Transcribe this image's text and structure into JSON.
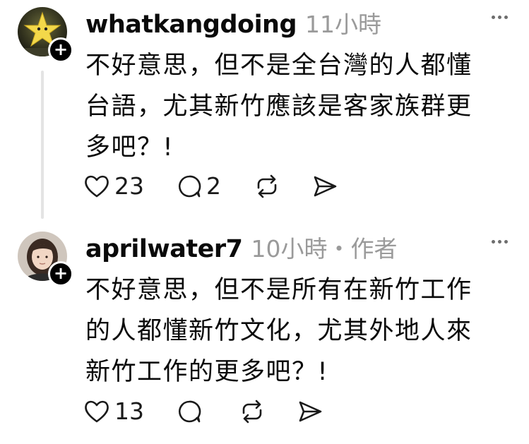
{
  "posts": [
    {
      "username": "whatkangdoing",
      "meta": "11小時",
      "content": "不好意思，但不是全台灣的人都懂\n台語，尤其新竹應該是客家族群更\n多吧？!",
      "likes": "23",
      "comments": "2",
      "avatar": "star-avatar",
      "follow_badge": "+"
    },
    {
      "username": "aprilwater7",
      "meta": "10小時・作者",
      "content": "不好意思，但不是所有在新竹工作\n的人都懂新竹文化，尤其外地人來\n新竹工作的更多吧？!",
      "likes": "13",
      "comments": "",
      "avatar": "person-avatar",
      "follow_badge": "+"
    }
  ],
  "icons": {
    "like": "heart-icon",
    "comment": "comment-icon",
    "repost": "repost-icon",
    "share": "share-icon",
    "more": "more-icon"
  },
  "colors": {
    "text": "#0a0a0a",
    "secondary": "#9a9a9a",
    "thread_line": "#e4e4e4"
  }
}
